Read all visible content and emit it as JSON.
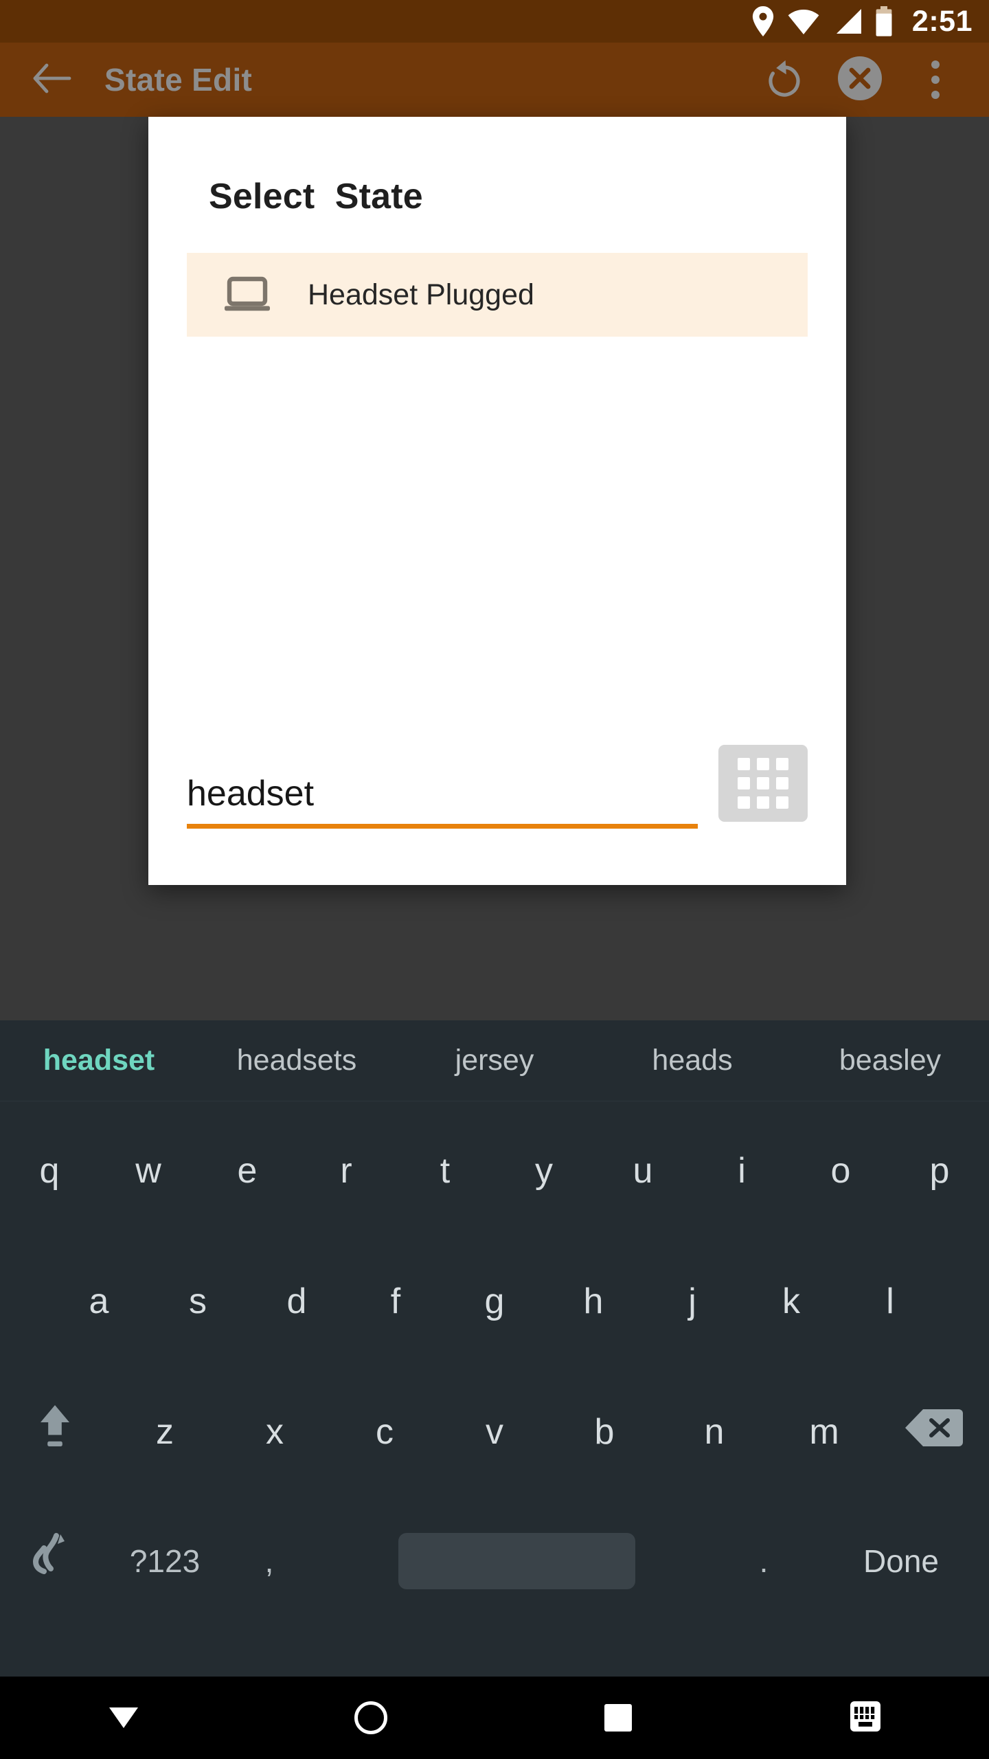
{
  "statusbar": {
    "time": "2:51",
    "icons": [
      "location-pin-icon",
      "wifi-icon",
      "signal-icon",
      "battery-icon"
    ]
  },
  "appbar": {
    "back_label": "back-arrow",
    "title": "State Edit",
    "actions": [
      "undo-icon",
      "cancel-icon",
      "overflow-menu-icon"
    ],
    "background_color": "#70380a",
    "title_color": "#8d8d8d"
  },
  "dialog": {
    "title": "Select  State",
    "list": [
      {
        "icon": "laptop-icon",
        "label": "Headset Plugged",
        "highlighted": true
      }
    ],
    "search": {
      "value": "headset",
      "placeholder": "",
      "underline_color": "#e8820c"
    },
    "grid_button": "grid-icon"
  },
  "keyboard": {
    "suggestions": [
      {
        "text": "headset",
        "active": true
      },
      {
        "text": "headsets",
        "active": false
      },
      {
        "text": "jersey",
        "active": false
      },
      {
        "text": "heads",
        "active": false
      },
      {
        "text": "beasley",
        "active": false
      }
    ],
    "row1": [
      "q",
      "w",
      "e",
      "r",
      "t",
      "y",
      "u",
      "i",
      "o",
      "p"
    ],
    "row2": [
      "a",
      "s",
      "d",
      "f",
      "g",
      "h",
      "j",
      "k",
      "l"
    ],
    "row3": [
      "z",
      "x",
      "c",
      "v",
      "b",
      "n",
      "m"
    ],
    "shift_key": "shift-icon",
    "backspace_key": "backspace-icon",
    "bottom": {
      "emoji_key": "gesture-typing-icon",
      "symbols_key": "?123",
      "comma_key": ",",
      "space_key": "space-bar",
      "period_key": ".",
      "done_key": "Done"
    },
    "accent_color": "#6fd6c0",
    "background_color": "#242c31"
  },
  "navbar": {
    "back": "collapse-keyboard-icon",
    "home": "home-icon",
    "recents": "recents-icon",
    "switch_keyboard": "keyboard-switch-icon"
  }
}
